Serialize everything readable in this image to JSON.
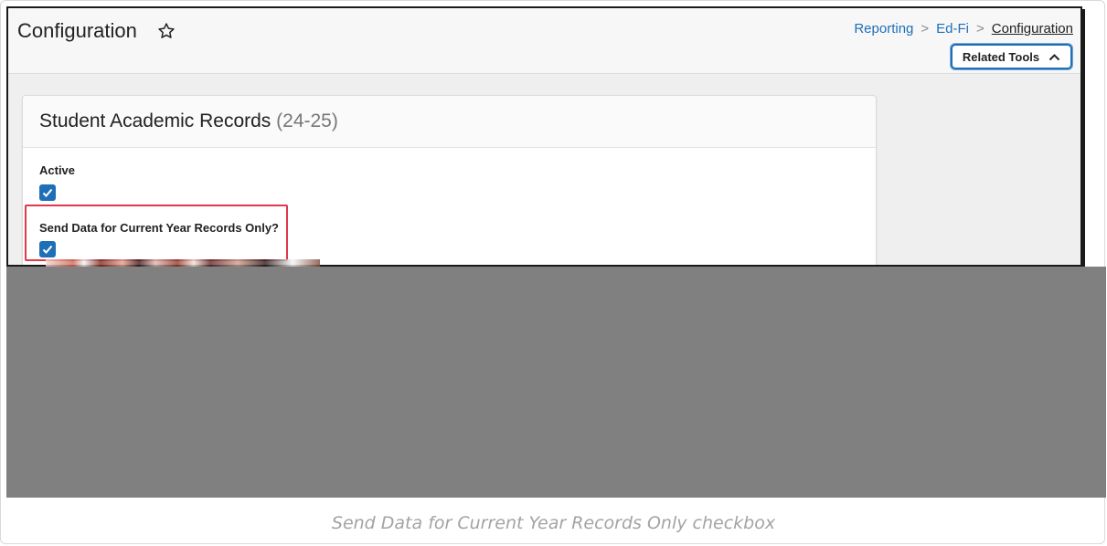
{
  "page": {
    "title": "Configuration",
    "star_icon": "star-outline-icon"
  },
  "breadcrumb": {
    "items": [
      "Reporting",
      "Ed-Fi",
      "Configuration"
    ],
    "separator": ">"
  },
  "related_tools": {
    "label": "Related Tools",
    "icon": "chevron-up-icon"
  },
  "card": {
    "title": "Student Academic Records",
    "year": "(24-25)",
    "fields": [
      {
        "label": "Active",
        "checked": true
      },
      {
        "label": "Send Data for Current Year Records Only?",
        "checked": true
      }
    ]
  },
  "colors": {
    "accent": "#1f6fb8",
    "highlight": "#e0394a",
    "redacted": "#808080"
  },
  "caption": "Send Data for Current Year Records Only checkbox"
}
